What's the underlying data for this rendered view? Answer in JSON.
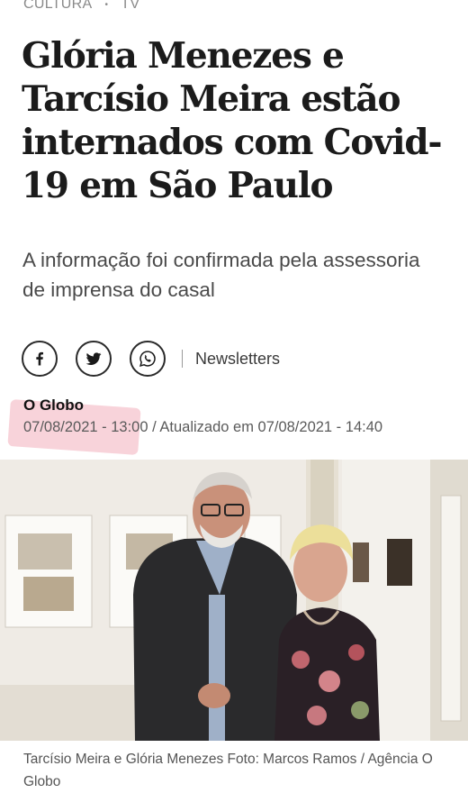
{
  "kicker": {
    "section": "CULTURA",
    "separator": "•",
    "subsection": "TV"
  },
  "headline": "Glória Menezes e Tarcísio Meira estão internados com Covid-19 em São Paulo",
  "subtitle": "A informação foi confirmada pela assessoria de imprensa do casal",
  "share": {
    "icons": [
      "facebook-icon",
      "twitter-icon",
      "whatsapp-icon"
    ],
    "newsletters_label": "Newsletters"
  },
  "byline": {
    "author": "O Globo",
    "dates": "07/08/2021 - 13:00 / Atualizado em 07/08/2021 - 14:40"
  },
  "photo": {
    "caption": "Tarcísio Meira e Glória Menezes Foto: Marcos Ramos / Agência O Globo"
  },
  "colors": {
    "highlight": "#ec8296",
    "headline": "#1b1b1b",
    "meta_text": "#5a5a5a"
  }
}
